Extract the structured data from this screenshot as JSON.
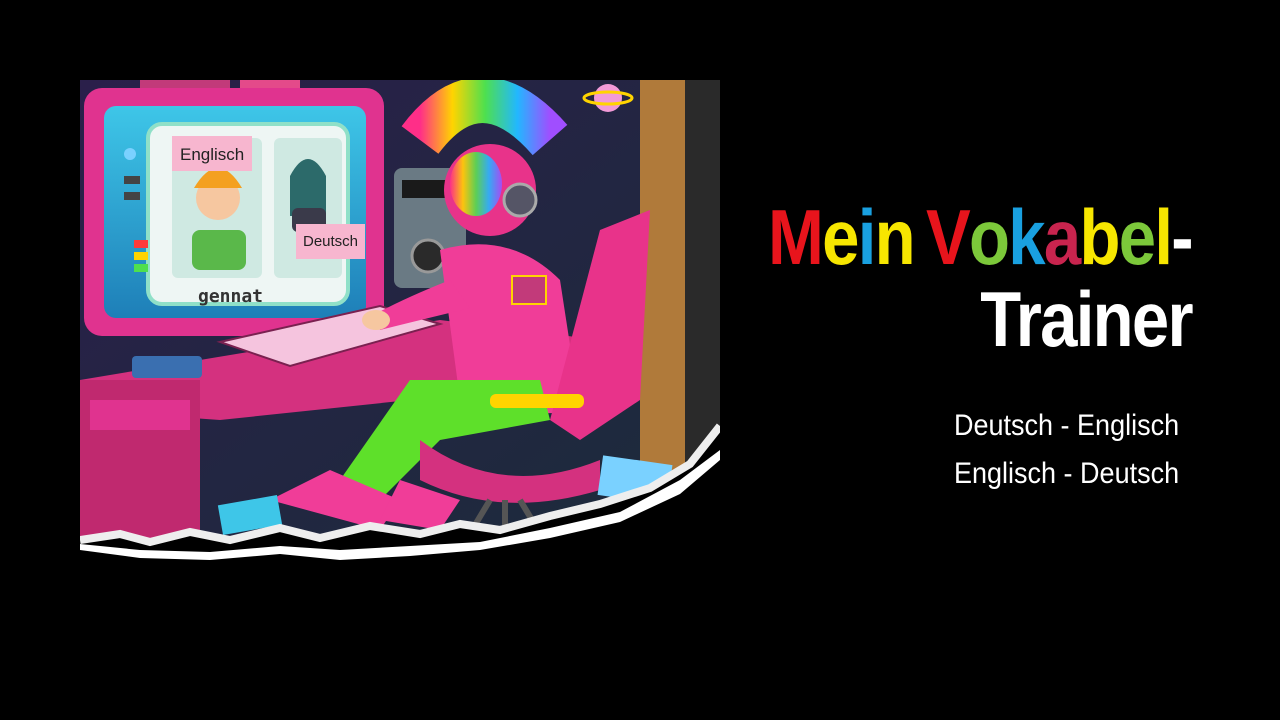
{
  "illustration": {
    "label_left": "Englisch",
    "label_right": "Deutsch",
    "screen_caption": "gennat"
  },
  "title": {
    "line1_letters": [
      {
        "ch": "M",
        "color": "#e8141c"
      },
      {
        "ch": "e",
        "color": "#f7e600"
      },
      {
        "ch": "i",
        "color": "#19a0e0"
      },
      {
        "ch": "n",
        "color": "#f7e600"
      },
      {
        "ch": " ",
        "color": "#ffffff"
      },
      {
        "ch": "V",
        "color": "#e8141c"
      },
      {
        "ch": "o",
        "color": "#7cc83a"
      },
      {
        "ch": "k",
        "color": "#19a0e0"
      },
      {
        "ch": "a",
        "color": "#c8244e"
      },
      {
        "ch": "b",
        "color": "#f7e600"
      },
      {
        "ch": "e",
        "color": "#7cc83a"
      },
      {
        "ch": "l",
        "color": "#f7e600"
      },
      {
        "ch": "-",
        "color": "#ffffff"
      }
    ],
    "line2": "Trainer",
    "line2_color": "#ffffff"
  },
  "subtitle": {
    "line1": "Deutsch - Englisch",
    "line2": "Englisch - Deutsch"
  }
}
